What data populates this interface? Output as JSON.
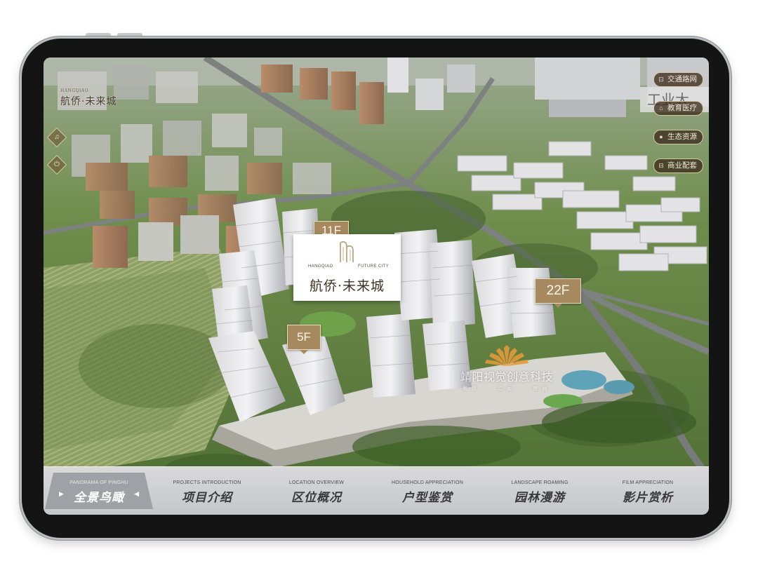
{
  "logo": {
    "en": "HANGQIAO",
    "cn": "航侨·未来城"
  },
  "left_controls": [
    {
      "icon": "music-icon",
      "glyph": "♫"
    },
    {
      "icon": "power-icon",
      "glyph": "⏻"
    }
  ],
  "right_nav": [
    {
      "label": "交通路网",
      "icon": "bus-icon",
      "glyph": "⊡"
    },
    {
      "label": "教育医疗",
      "icon": "school-icon",
      "glyph": "⌂"
    },
    {
      "label": "生态资源",
      "icon": "leaf-icon",
      "glyph": "●"
    },
    {
      "label": "商业配套",
      "icon": "shop-icon",
      "glyph": "⊟"
    }
  ],
  "corner_sign": "工业大",
  "floor_tags": {
    "tag_11f": "11F",
    "tag_22f": "22F",
    "tag_5f": "5F"
  },
  "brand_card": {
    "en_left": "HANGQIAO",
    "en_right": "FUTURE CITY",
    "cn": "航侨·未来城"
  },
  "watermark": {
    "cn": "靖阳视觉创意科技",
    "sub": "景观 · 动画 · 官网"
  },
  "bottom_tabs": [
    {
      "en": "PANORAMA OF PINGHU",
      "cn": "全景鸟瞰",
      "active": true
    },
    {
      "en": "PROJECTS INTRODUCTION",
      "cn": "项目介绍",
      "active": false
    },
    {
      "en": "LOCATION OVERVIEW",
      "cn": "区位概况",
      "active": false
    },
    {
      "en": "HOUSEHOLD APPRECIATION",
      "cn": "户型鉴赏",
      "active": false
    },
    {
      "en": "LANDSCAPE ROAMING",
      "cn": "园林漫游",
      "active": false
    },
    {
      "en": "FILM APPRECIATION",
      "cn": "影片赏析",
      "active": false
    }
  ]
}
